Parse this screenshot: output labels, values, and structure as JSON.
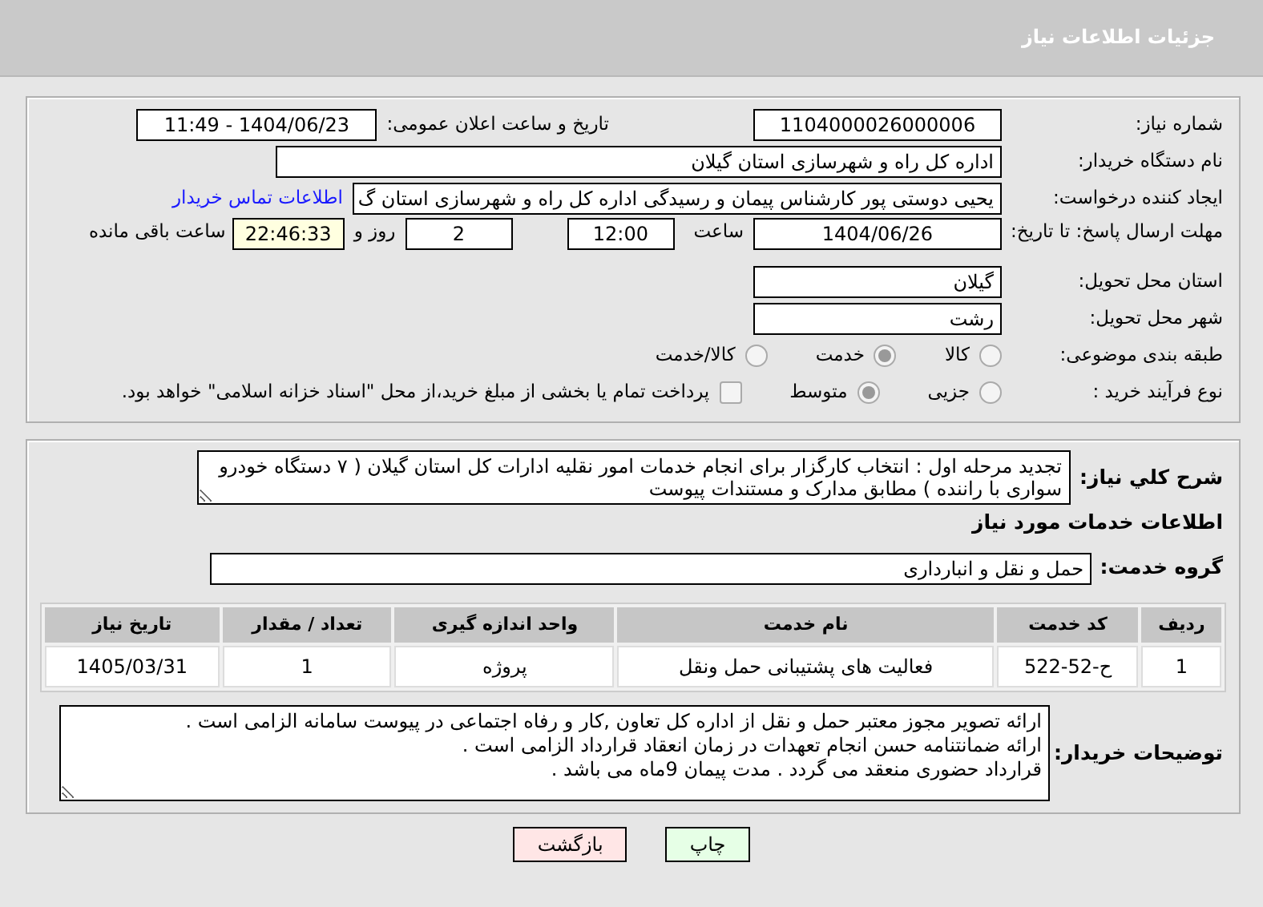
{
  "header": {
    "title": "جزئیات اطلاعات نیاز"
  },
  "need_number": {
    "label": "شماره نیاز:",
    "value": "1104000026000006"
  },
  "announce": {
    "label": "تاریخ و ساعت اعلان عمومی:",
    "value": "1404/06/23 - 11:49"
  },
  "buyer_org": {
    "label": "نام دستگاه خریدار:",
    "value": "اداره کل راه و شهرسازی استان گیلان"
  },
  "requester": {
    "label": "ایجاد کننده درخواست:",
    "value": "یحیی دوستی پور کارشناس پیمان و رسیدگی اداره کل راه و شهرسازی استان گ",
    "link": "اطلاعات تماس خریدار"
  },
  "deadline": {
    "label": "مهلت ارسال پاسخ: تا تاریخ:",
    "date": "1404/06/26",
    "time_label": "ساعت",
    "time": "12:00",
    "days": "2",
    "days_label": "روز و",
    "remaining": "22:46:33",
    "remaining_label": "ساعت باقی مانده"
  },
  "province": {
    "label": "استان محل تحویل:",
    "value": "گیلان"
  },
  "city": {
    "label": "شهر محل تحویل:",
    "value": "رشت"
  },
  "category": {
    "label": "طبقه بندی موضوعی:",
    "options": [
      {
        "label": "کالا",
        "selected": false
      },
      {
        "label": "خدمت",
        "selected": true
      },
      {
        "label": "کالا/خدمت",
        "selected": false
      }
    ]
  },
  "process": {
    "label": "نوع فرآیند خرید :",
    "options": [
      {
        "label": "جزیی",
        "selected": false
      },
      {
        "label": "متوسط",
        "selected": true
      }
    ],
    "payment": {
      "label": "پرداخت تمام یا بخشی از مبلغ خرید،از محل \"اسناد خزانه اسلامی\" خواهد بود.",
      "checked": false
    }
  },
  "description": {
    "label": "شرح کلي نياز:",
    "value": "تجدید مرحله اول : انتخاب کارگزار برای انجام خدمات امور نقلیه ادارات کل استان گیلان ( ۷ دستگاه خودرو سواری با راننده ) مطابق مدارک و مستندات پیوست"
  },
  "services_title": "اطلاعات خدمات مورد نیاز",
  "service_group": {
    "label": "گروه خدمت:",
    "value": "حمل و نقل و انبارداری"
  },
  "table": {
    "columns": [
      "ردیف",
      "کد خدمت",
      "نام خدمت",
      "واحد اندازه گیری",
      "تعداد / مقدار",
      "تاریخ نیاز"
    ],
    "rows": [
      [
        "1",
        "ح-52-522",
        "فعالیت های پشتیبانی حمل ونقل",
        "پروژه",
        "1",
        "1405/03/31"
      ]
    ]
  },
  "buyer_notes": {
    "label": "توضیحات خریدار:",
    "value": "ارائه تصویر مجوز معتبر حمل و نقل از اداره کل تعاون ,کار و رفاه اجتماعی در پیوست سامانه الزامی است .\nارائه ضمانتنامه حسن انجام تعهدات در زمان انعقاد قرارداد الزامی است .\nقرارداد حضوری منعقد می گردد . مدت پیمان 9ماه می باشد ."
  },
  "buttons": [
    {
      "label": "چاپ",
      "kind": "print"
    },
    {
      "label": "بازگشت",
      "kind": "back"
    }
  ]
}
